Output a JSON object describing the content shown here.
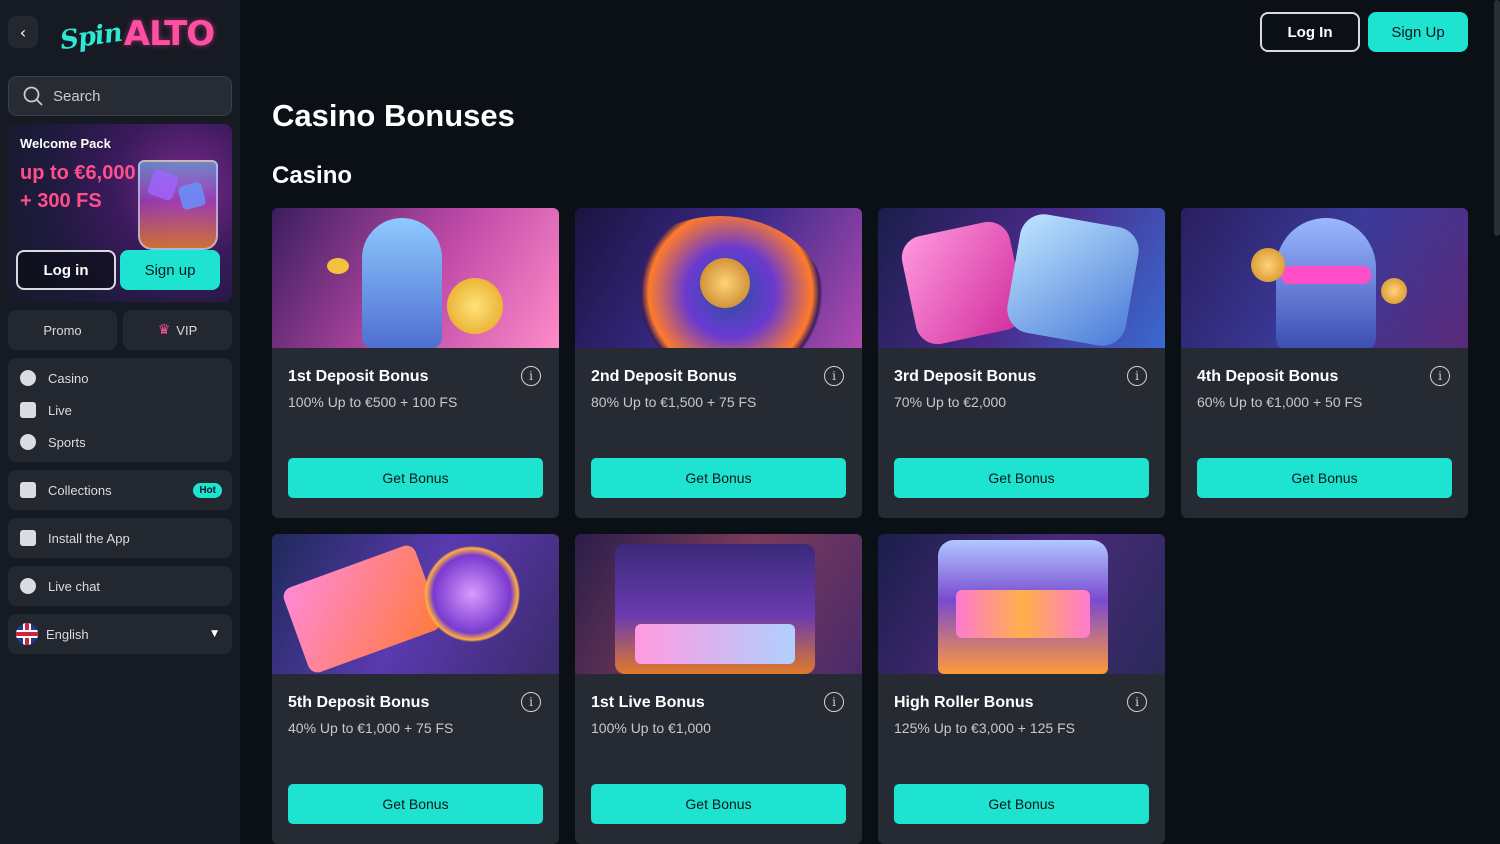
{
  "brand": {
    "logo_script": "Spin",
    "logo_word": "ALTO"
  },
  "sidebar": {
    "search_placeholder": "Search",
    "welcome": {
      "title": "Welcome Pack",
      "line1": "up to €6,000",
      "line2": "+ 300 FS",
      "login_label": "Log in",
      "signup_label": "Sign up"
    },
    "tabs": {
      "promo": "Promo",
      "vip": "VIP"
    },
    "nav": [
      "Casino",
      "Live",
      "Sports"
    ],
    "collections": {
      "label": "Collections",
      "badge": "Hot"
    },
    "install_label": "Install the App",
    "live_chat_label": "Live chat",
    "language_label": "English"
  },
  "header": {
    "login_label": "Log In",
    "signup_label": "Sign Up"
  },
  "main": {
    "page_title": "Casino Bonuses",
    "section_title": "Casino",
    "cards": [
      {
        "title": "1st Deposit Bonus",
        "desc": "100% Up to €500 + 100 FS",
        "button": "Get Bonus"
      },
      {
        "title": "2nd Deposit Bonus",
        "desc": "80% Up to €1,500 + 75 FS",
        "button": "Get Bonus"
      },
      {
        "title": "3rd Deposit Bonus",
        "desc": "70% Up to €2,000",
        "button": "Get Bonus"
      },
      {
        "title": "4th Deposit Bonus",
        "desc": "60% Up to €1,000 + 50 FS",
        "button": "Get Bonus"
      },
      {
        "title": "5th Deposit Bonus",
        "desc": "40% Up to €1,000 + 75 FS",
        "button": "Get Bonus"
      },
      {
        "title": "1st Live Bonus",
        "desc": "100% Up to €1,000",
        "button": "Get Bonus"
      },
      {
        "title": "High Roller Bonus",
        "desc": "125% Up to €3,000 + 125 FS",
        "button": "Get Bonus"
      }
    ]
  },
  "colors": {
    "accent": "#1ee3d0",
    "brand_pink": "#ff4fa3",
    "background": "#0b0f16",
    "card": "#262a33"
  }
}
